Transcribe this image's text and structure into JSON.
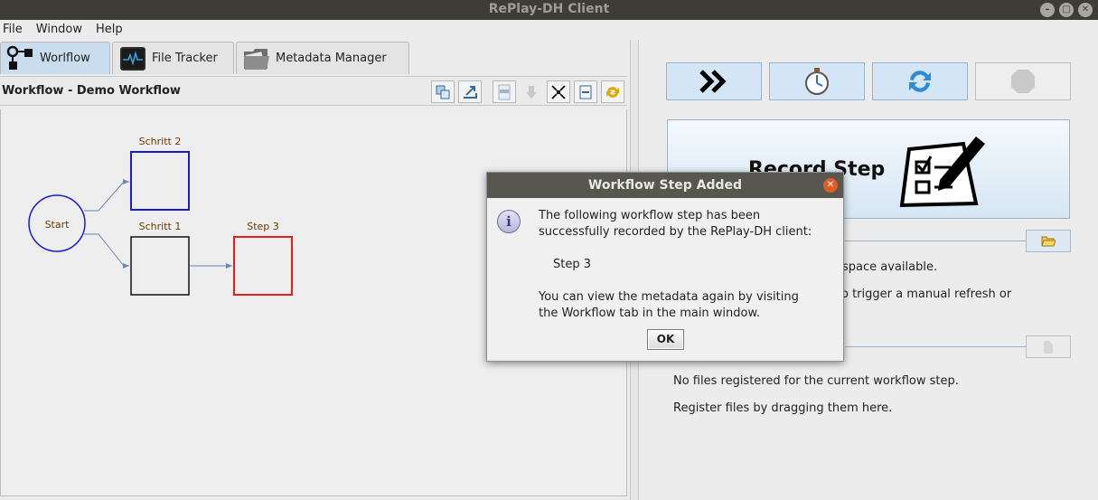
{
  "window": {
    "title": "RePlay-DH Client"
  },
  "menu": [
    "File",
    "Window",
    "Help"
  ],
  "tabs": [
    {
      "label": "Worlflow",
      "icon": "workflow-icon",
      "active": true
    },
    {
      "label": "File Tracker",
      "icon": "monitor-icon",
      "active": false
    },
    {
      "label": "Metadata Manager",
      "icon": "folder-icon",
      "active": false
    }
  ],
  "workflow": {
    "title": "Workflow - Demo Workflow",
    "nodes": [
      {
        "label": "Start",
        "shape": "circle",
        "color": "#1a1adb"
      },
      {
        "label": "Schritt 2",
        "shape": "box",
        "color": "#1a1adb"
      },
      {
        "label": "Schritt 1",
        "shape": "box",
        "color": "#111111"
      },
      {
        "label": "Step 3",
        "shape": "box",
        "color": "#e02020"
      }
    ],
    "label_color": "#6b3a00"
  },
  "right": {
    "record_label": "Record Step",
    "workspace_text": "space available.",
    "refresh_text": "o trigger a manual refresh or",
    "no_files_text": "No files registered for the current workflow step.",
    "register_text": "Register files by dragging them here."
  },
  "dialog": {
    "title": "Workflow Step Added",
    "line1": "The following workflow step has been",
    "line2": "successfully recorded by the RePlay-DH client:",
    "step_name": "Step 3",
    "line3": "You can view the metadata again by visiting",
    "line4": "the Workflow tab in the main window.",
    "ok_label": "OK"
  }
}
